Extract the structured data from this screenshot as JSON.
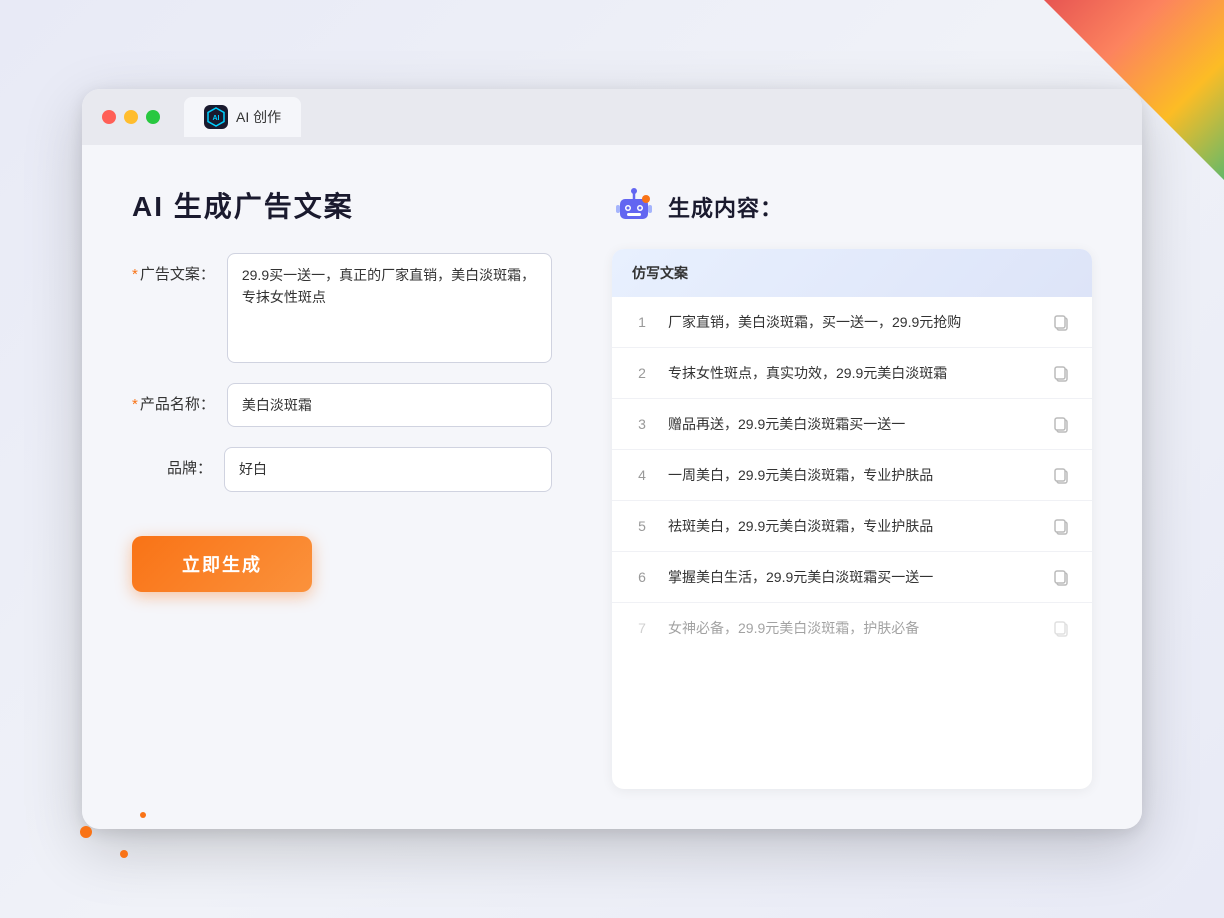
{
  "window": {
    "traffic_lights": [
      "red",
      "yellow",
      "green"
    ],
    "tab_label": "AI 创作"
  },
  "left_panel": {
    "title": "AI 生成广告文案",
    "form": {
      "ad_copy_label": "广告文案：",
      "ad_copy_required": "*",
      "ad_copy_value": "29.9买一送一，真正的厂家直销，美白淡斑霜，专抹女性斑点",
      "product_name_label": "产品名称：",
      "product_name_required": "*",
      "product_name_value": "美白淡斑霜",
      "brand_label": "品牌：",
      "brand_value": "好白",
      "generate_button": "立即生成"
    }
  },
  "right_panel": {
    "title": "生成内容：",
    "results_header": "仿写文案",
    "results": [
      {
        "id": 1,
        "text": "厂家直销，美白淡斑霜，买一送一，29.9元抢购",
        "faded": false
      },
      {
        "id": 2,
        "text": "专抹女性斑点，真实功效，29.9元美白淡斑霜",
        "faded": false
      },
      {
        "id": 3,
        "text": "赠品再送，29.9元美白淡斑霜买一送一",
        "faded": false
      },
      {
        "id": 4,
        "text": "一周美白，29.9元美白淡斑霜，专业护肤品",
        "faded": false
      },
      {
        "id": 5,
        "text": "祛斑美白，29.9元美白淡斑霜，专业护肤品",
        "faded": false
      },
      {
        "id": 6,
        "text": "掌握美白生活，29.9元美白淡斑霜买一送一",
        "faded": false
      },
      {
        "id": 7,
        "text": "女神必备，29.9元美白淡斑霜，护肤必备",
        "faded": true
      }
    ]
  }
}
